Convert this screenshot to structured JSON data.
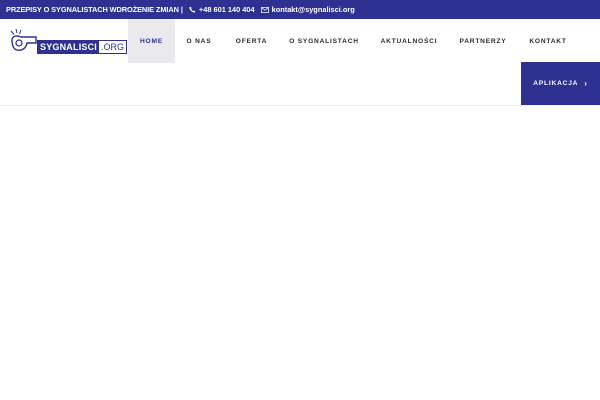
{
  "topbar": {
    "notice": "PRZEPISY O SYGNALISTACH WDROŻENIE ZMIAN",
    "separator": "|",
    "phone": "+48 601 140 404",
    "email": "kontakt@sygnalisci.org",
    "background": "#2e3192"
  },
  "logo": {
    "name": "SYGNALISCI",
    "tld": ".ORG",
    "icon": "whistle-icon"
  },
  "nav": {
    "items": [
      {
        "label": "HOME",
        "active": true
      },
      {
        "label": "O NAS",
        "active": false
      },
      {
        "label": "OFERTA",
        "active": false
      },
      {
        "label": "O SYGNALISTACH",
        "active": false
      },
      {
        "label": "AKTUALNOŚCI",
        "active": false
      },
      {
        "label": "PARTNERZY",
        "active": false
      },
      {
        "label": "KONTAKT",
        "active": false
      }
    ]
  },
  "cta": {
    "label": "APLIKACJA",
    "chevron": "›",
    "icon": "chevron-right-icon",
    "background": "#2e3192"
  }
}
